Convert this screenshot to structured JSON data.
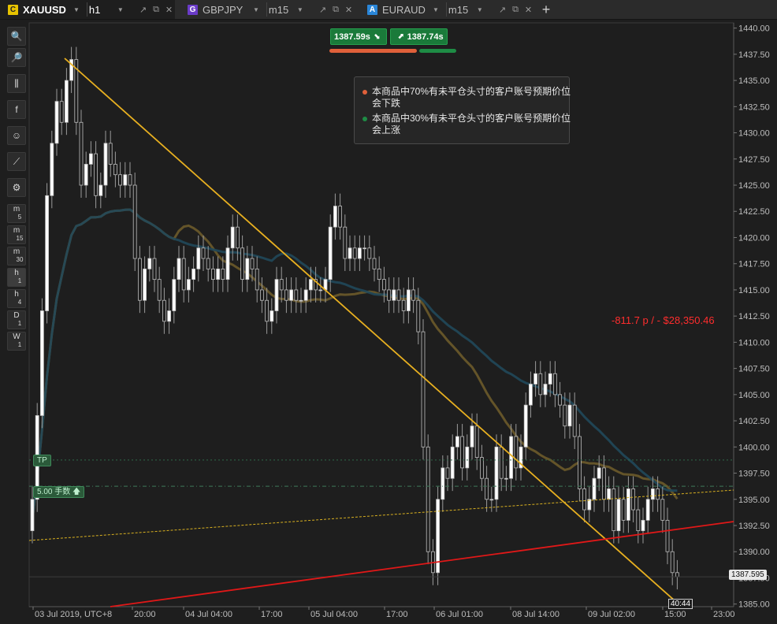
{
  "tabs": [
    {
      "badge": "C",
      "badge_color": "#e6c200",
      "symbol": "XAUUSD",
      "timeframe": "h1",
      "active": true
    },
    {
      "badge": "G",
      "badge_color": "#6a3bc8",
      "symbol": "GBPJPY",
      "timeframe": "m15",
      "active": false
    },
    {
      "badge": "A",
      "badge_color": "#2a86d8",
      "symbol": "EURAUD",
      "timeframe": "m15",
      "active": false
    }
  ],
  "tab_icons": {
    "popout": "↗",
    "detach": "⧉",
    "close": "✕",
    "add": "+"
  },
  "sidebar": {
    "tools": [
      "zoom-in-icon",
      "zoom-out-icon",
      "chart-type-icon",
      "facebook-icon",
      "robot-icon",
      "drawing-icon",
      "settings-icon"
    ],
    "timeframes": [
      {
        "top": "m",
        "sub": "5"
      },
      {
        "top": "m",
        "sub": "15"
      },
      {
        "top": "m",
        "sub": "30"
      },
      {
        "top": "h",
        "sub": "1"
      },
      {
        "top": "h",
        "sub": "4"
      },
      {
        "top": "D",
        "sub": "1"
      },
      {
        "top": "W",
        "sub": "1"
      }
    ],
    "active_timeframe": "h1"
  },
  "quote": {
    "sell": "1387.59",
    "sell_suffix": "s",
    "buy": "1387.74",
    "buy_suffix": "s"
  },
  "sentiment": {
    "sell_pct": 70,
    "buy_pct": 30,
    "sell_text": "本商品中70%有未平仓头寸的客户账号预期价位会下跌",
    "buy_text": "本商品中30%有未平仓头寸的客户账号预期价位会上涨",
    "sell_color": "#e0603a",
    "buy_color": "#1e8c45"
  },
  "position": {
    "pl_text": "-811.7 p / - $28,350.46",
    "tp_label": "TP",
    "lot_label": "5.00 手数"
  },
  "current": {
    "price": "1387.595",
    "countdown": "40:44"
  },
  "chart_data": {
    "type": "candlestick",
    "symbol": "XAUUSD",
    "timeframe": "h1",
    "y_ticks": [
      "1440.00",
      "1437.50",
      "1435.00",
      "1432.50",
      "1430.00",
      "1427.50",
      "1425.00",
      "1422.50",
      "1420.00",
      "1417.50",
      "1415.00",
      "1412.50",
      "1410.00",
      "1407.50",
      "1405.00",
      "1402.50",
      "1400.00",
      "1397.50",
      "1395.00",
      "1392.50",
      "1390.00",
      "1387.50",
      "1385.00"
    ],
    "ylim": [
      1384.75,
      1440.5
    ],
    "x_ticks": [
      "03 Jul 2019, UTC+8",
      "20:00",
      "04 Jul 04:00",
      "17:00",
      "05 Jul 04:00",
      "17:00",
      "06 Jul 01:00",
      "08 Jul 14:00",
      "09 Jul 02:00",
      "15:00",
      "23:00"
    ],
    "last_price": 1387.595,
    "tp_level": 1398.75,
    "entry_level": 1396.25,
    "closes": [
      1395,
      1403,
      1413,
      1424,
      1429,
      1433,
      1431,
      1435,
      1437,
      1431,
      1425,
      1427,
      1428,
      1424,
      1425,
      1429,
      1427,
      1426,
      1425,
      1426,
      1425,
      1418,
      1414,
      1417,
      1418,
      1416,
      1414,
      1412,
      1413,
      1416,
      1418,
      1415,
      1416,
      1417,
      1419,
      1418,
      1417,
      1416,
      1417,
      1416,
      1419,
      1421,
      1419,
      1416,
      1418,
      1417,
      1415,
      1414,
      1412,
      1413,
      1416,
      1415,
      1414,
      1415,
      1414,
      1414,
      1415,
      1416,
      1415,
      1415,
      1416,
      1421,
      1423,
      1421,
      1418,
      1419,
      1418,
      1419,
      1419,
      1418,
      1417,
      1416,
      1415,
      1414,
      1415,
      1414,
      1413,
      1415,
      1414,
      1411,
      1400,
      1390,
      1388,
      1395,
      1398,
      1397,
      1400,
      1401,
      1398,
      1400,
      1402,
      1399,
      1397,
      1395,
      1395,
      1400,
      1397,
      1397,
      1401,
      1398,
      1400,
      1404,
      1406,
      1407,
      1405,
      1406,
      1407,
      1405,
      1404,
      1402,
      1404,
      1401,
      1396,
      1394,
      1395,
      1397,
      1398,
      1395,
      1396,
      1392,
      1395,
      1393,
      1396,
      1394,
      1392,
      1393,
      1395,
      1396,
      1395,
      1393,
      1390,
      1388,
      1387.6
    ]
  }
}
